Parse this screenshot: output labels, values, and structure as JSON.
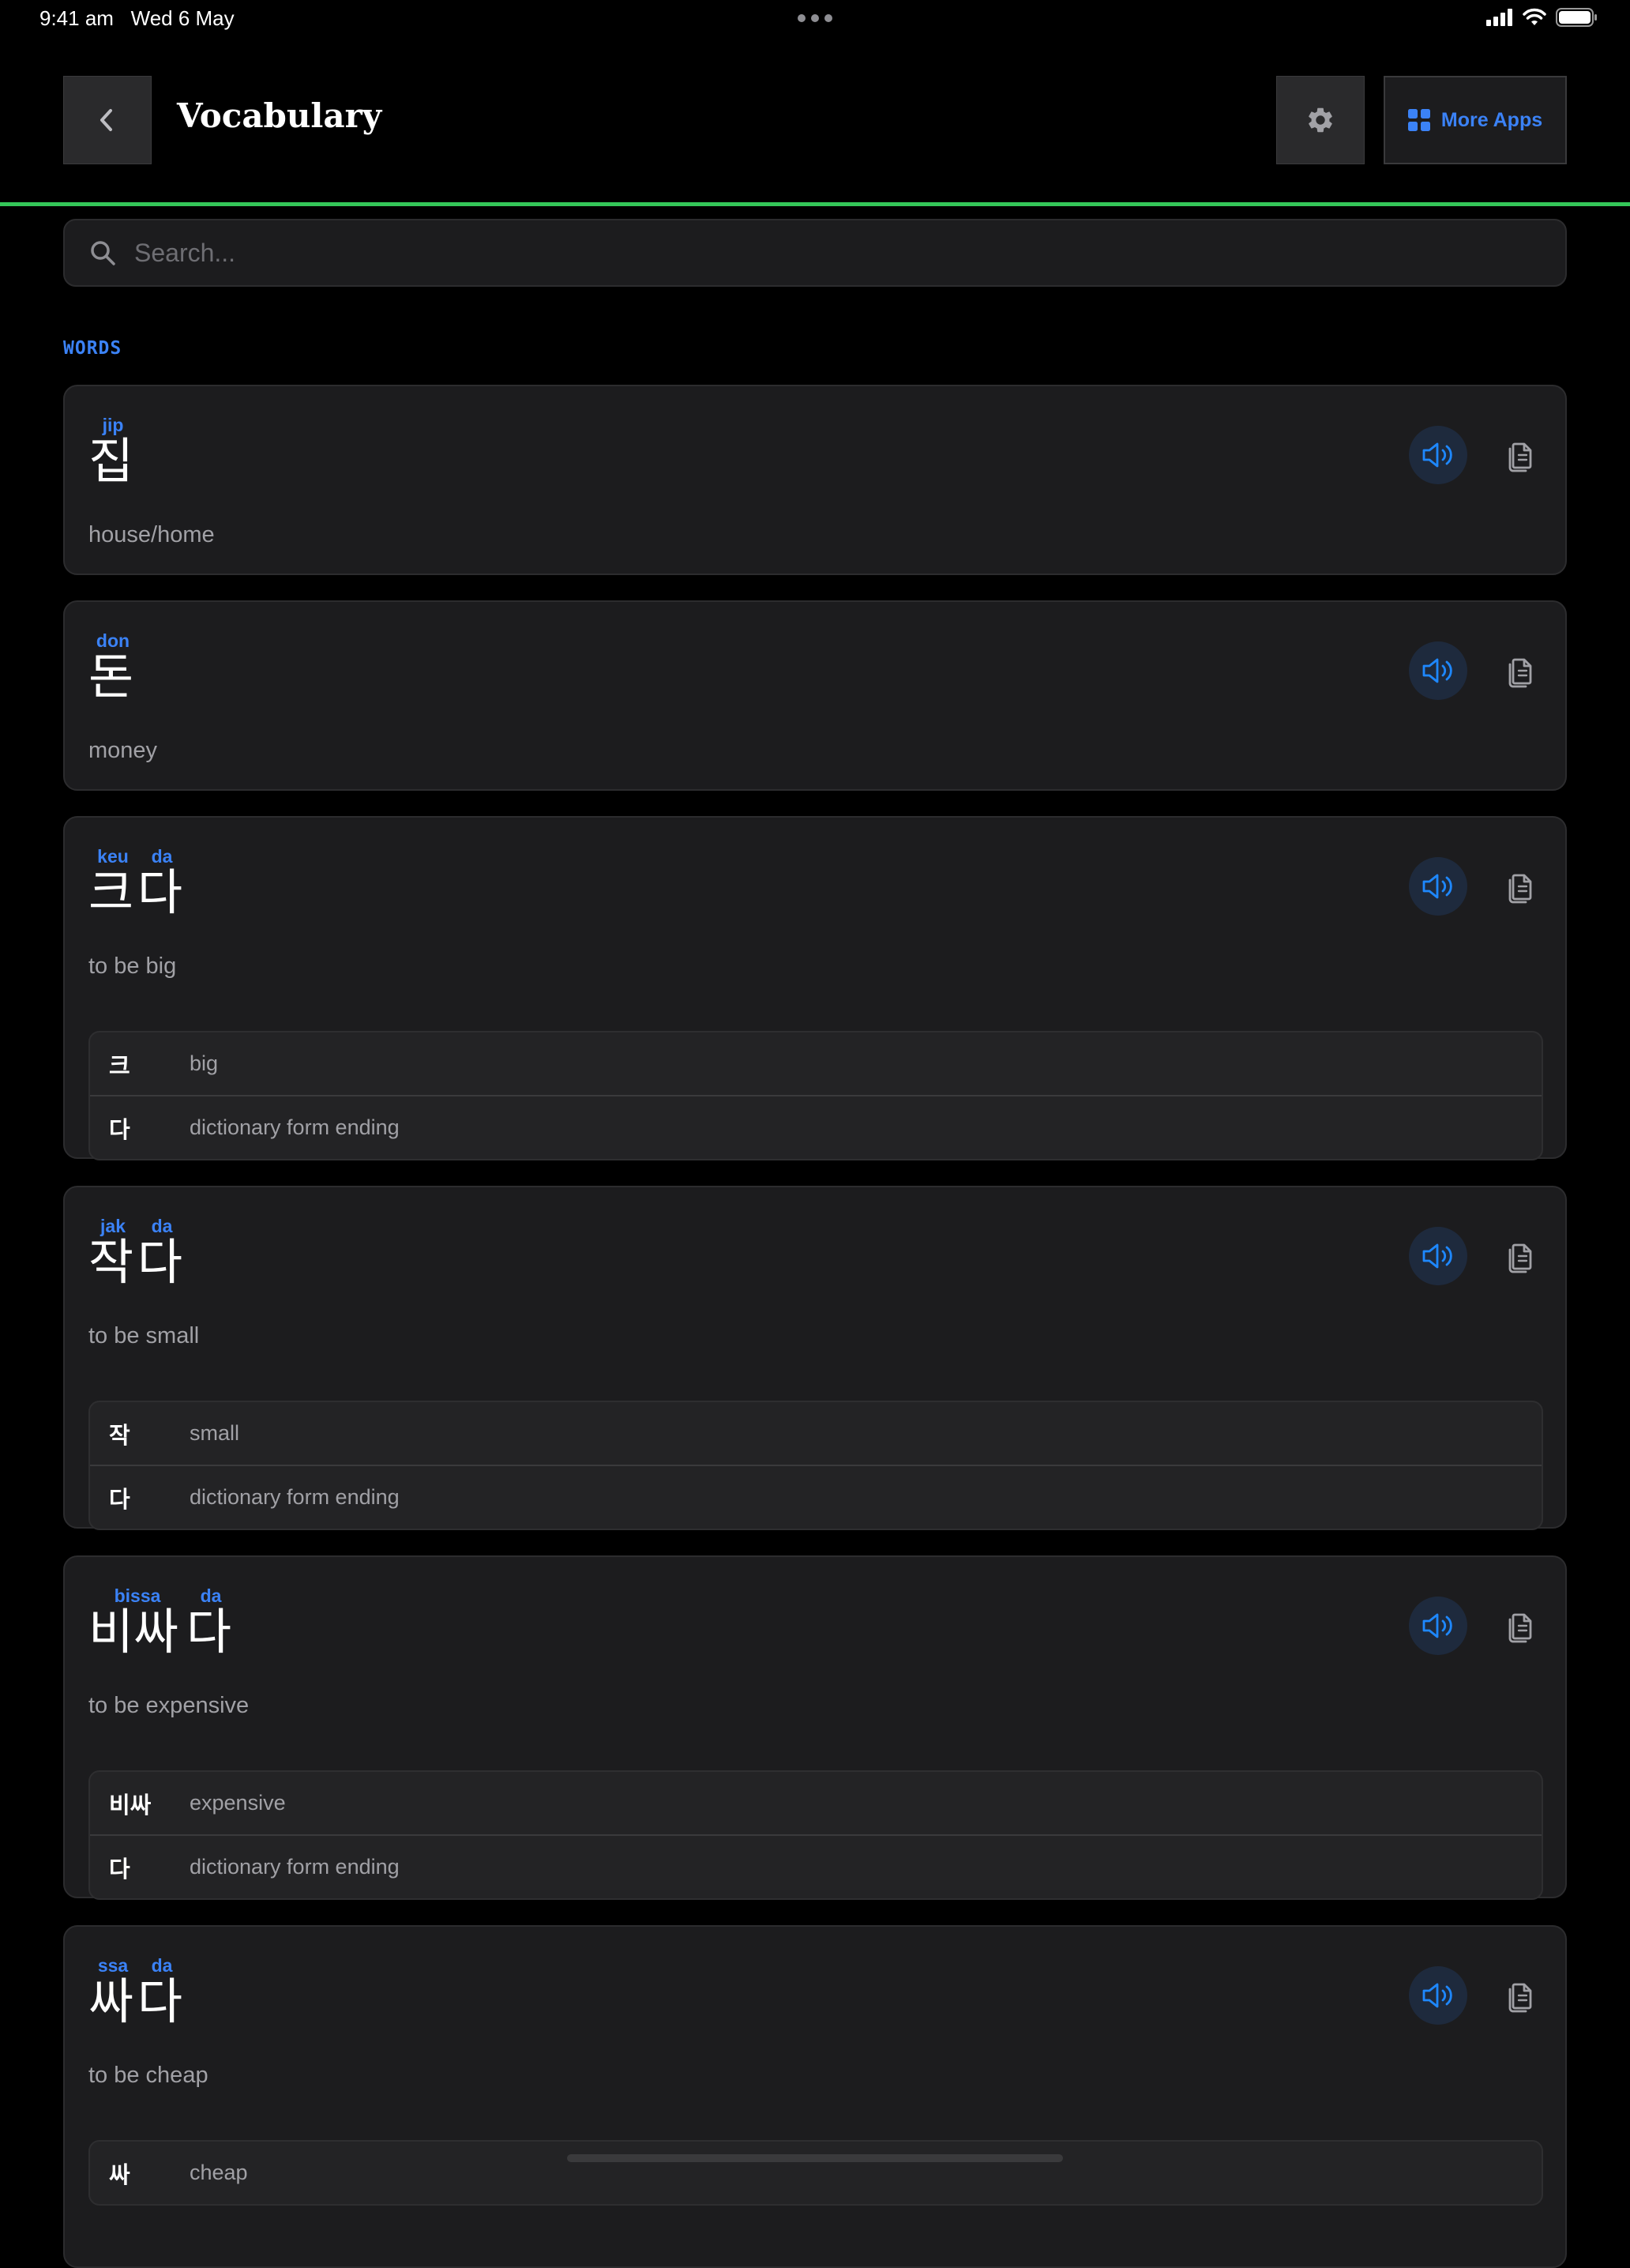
{
  "status_bar": {
    "time": "9:41 am",
    "date": "Wed 6 May"
  },
  "header": {
    "title": "Vocabulary",
    "more_apps_label": "More Apps"
  },
  "search": {
    "placeholder": "Search..."
  },
  "section_label": "WORDS",
  "colors": {
    "accent": "#3b82f6",
    "progress": "#34c759",
    "background": "#000000",
    "card": "#1c1c1e"
  },
  "icons": {
    "back": "chevron-left-icon",
    "settings": "gear-icon",
    "apps": "grid-icon",
    "search": "search-icon",
    "speak": "speaker-icon",
    "copy": "copy-icon"
  },
  "words": [
    {
      "syllables": [
        "집"
      ],
      "romanization": [
        "jip"
      ],
      "meaning": "house/home",
      "breakdown": []
    },
    {
      "syllables": [
        "돈"
      ],
      "romanization": [
        "don"
      ],
      "meaning": "money",
      "breakdown": []
    },
    {
      "syllables": [
        "크",
        "다"
      ],
      "romanization": [
        "keu",
        "da"
      ],
      "meaning": "to be big",
      "breakdown": [
        {
          "part": "크",
          "meaning": "big"
        },
        {
          "part": "다",
          "meaning": "dictionary form ending"
        }
      ]
    },
    {
      "syllables": [
        "작",
        "다"
      ],
      "romanization": [
        "jak",
        "da"
      ],
      "meaning": "to be small",
      "breakdown": [
        {
          "part": "작",
          "meaning": "small"
        },
        {
          "part": "다",
          "meaning": "dictionary form ending"
        }
      ]
    },
    {
      "syllables": [
        "비싸",
        "다"
      ],
      "romanization": [
        "bissa",
        "da"
      ],
      "meaning": "to be expensive",
      "breakdown": [
        {
          "part": "비싸",
          "meaning": "expensive"
        },
        {
          "part": "다",
          "meaning": "dictionary form ending"
        }
      ]
    },
    {
      "syllables": [
        "싸",
        "다"
      ],
      "romanization": [
        "ssa",
        "da"
      ],
      "meaning": "to be cheap",
      "breakdown": [
        {
          "part": "싸",
          "meaning": "cheap"
        }
      ]
    }
  ]
}
